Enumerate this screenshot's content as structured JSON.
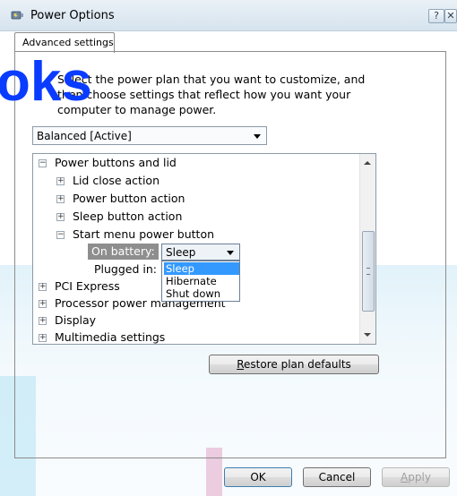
{
  "window": {
    "title": "Power Options",
    "help_label": "?",
    "close_label": "✕"
  },
  "tab": {
    "label": "Advanced settings"
  },
  "logo": {
    "text": "oks",
    "color": "#0a3cff"
  },
  "intro": {
    "line1": "Select the power plan that you want to customize, and",
    "line2": "then choose settings that reflect how you want your",
    "line3": "computer to manage power."
  },
  "plan_select": {
    "value": "Balanced [Active]"
  },
  "tree": {
    "power_buttons": {
      "label": "Power buttons and lid",
      "state": "expanded"
    },
    "lid_close": {
      "label": "Lid close action",
      "state": "collapsed"
    },
    "power_button": {
      "label": "Power button action",
      "state": "collapsed"
    },
    "sleep_button": {
      "label": "Sleep button action",
      "state": "collapsed"
    },
    "start_menu": {
      "label": "Start menu power button",
      "state": "expanded"
    },
    "on_battery": {
      "label": "On battery:",
      "value": "Sleep"
    },
    "plugged_in": {
      "label": "Plugged in:"
    },
    "pci_express": {
      "label": "PCI Express"
    },
    "processor": {
      "label": "Processor power management"
    },
    "display": {
      "label": "Display"
    },
    "multimedia": {
      "label": "Multimedia settings"
    }
  },
  "dropdown": {
    "options": [
      "Sleep",
      "Hibernate",
      "Shut down"
    ],
    "selected": "Sleep"
  },
  "buttons": {
    "restore_prefix": "",
    "restore_underlined": "R",
    "restore_rest": "estore plan defaults",
    "ok": "OK",
    "cancel": "Cancel",
    "apply_underlined": "A",
    "apply_rest": "pply"
  }
}
